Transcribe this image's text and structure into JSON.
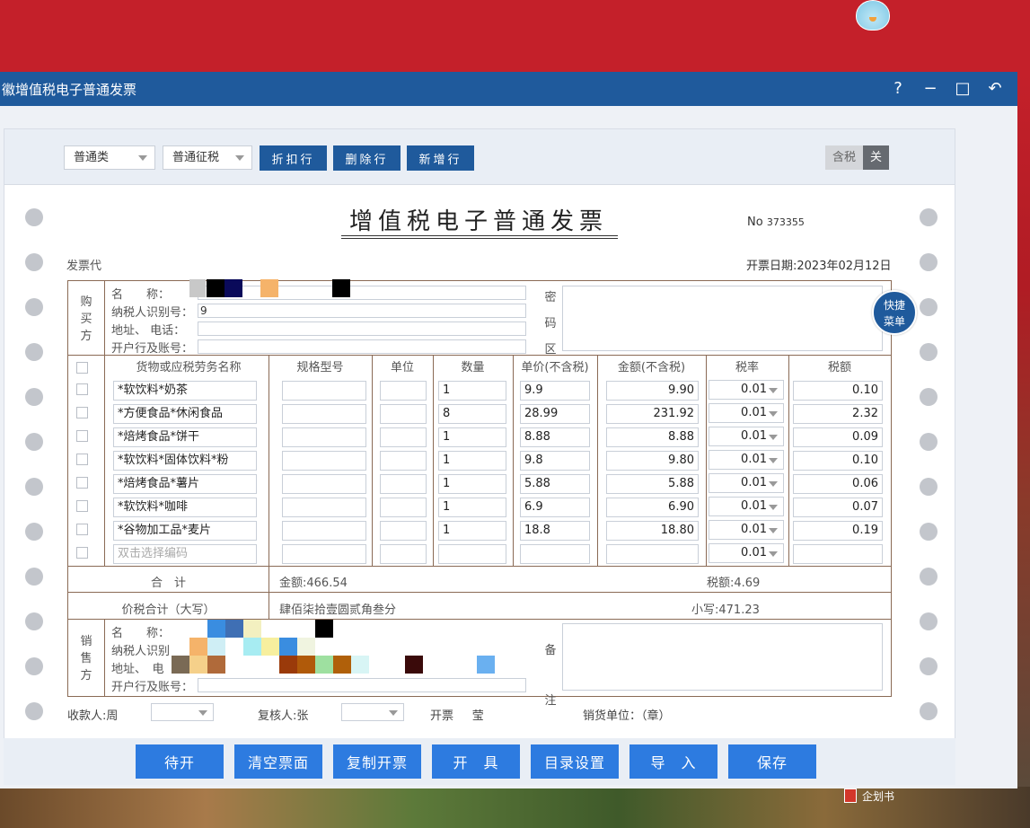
{
  "window": {
    "title": "徽增值税电子普通发票",
    "controls": [
      "?",
      "−",
      "□",
      "↶"
    ]
  },
  "toolbar": {
    "invoice_kind": "普通类",
    "tax_mode": "普通征税",
    "discount_btn": "折扣行",
    "delete_btn": "删除行",
    "add_btn": "新增行",
    "tax_included_on": "含税",
    "tax_included_off": "关"
  },
  "invoice": {
    "title": "增值税电子普通发票",
    "no_label": "No",
    "no_value": "373355",
    "code_label": "发票代",
    "date_label": "开票日期:",
    "date_value": "2023年02月12日"
  },
  "buyer": {
    "side_label": "购买方",
    "name_label": "名　　称：",
    "taxid_label": "纳税人识别号：",
    "taxid_value": "9",
    "addr_label": "地址、 电话：",
    "bank_label": "开户行及账号：",
    "cipher_label": "密码区"
  },
  "table": {
    "headers": [
      "货物或应税劳务名称",
      "规格型号",
      "单位",
      "数量",
      "单价(不含税)",
      "金额(不含税)",
      "税率",
      "税额"
    ],
    "rows": [
      {
        "name": "*软饮料*奶茶",
        "qty": "1",
        "price": "9.9",
        "amount": "9.90",
        "rate": "0.01",
        "tax": "0.10"
      },
      {
        "name": "*方便食品*休闲食品",
        "qty": "8",
        "price": "28.99",
        "amount": "231.92",
        "rate": "0.01",
        "tax": "2.32"
      },
      {
        "name": "*焙烤食品*饼干",
        "qty": "1",
        "price": "8.88",
        "amount": "8.88",
        "rate": "0.01",
        "tax": "0.09"
      },
      {
        "name": "*软饮料*固体饮料*粉",
        "qty": "1",
        "price": "9.8",
        "amount": "9.80",
        "rate": "0.01",
        "tax": "0.10"
      },
      {
        "name": "*焙烤食品*薯片",
        "qty": "1",
        "price": "5.88",
        "amount": "5.88",
        "rate": "0.01",
        "tax": "0.06"
      },
      {
        "name": "*软饮料*咖啡",
        "qty": "1",
        "price": "6.9",
        "amount": "6.90",
        "rate": "0.01",
        "tax": "0.07"
      },
      {
        "name": "*谷物加工品*麦片",
        "qty": "1",
        "price": "18.8",
        "amount": "18.80",
        "rate": "0.01",
        "tax": "0.19"
      }
    ],
    "empty_row": {
      "name_placeholder": "双击选择编码",
      "rate": "0.01"
    }
  },
  "totals": {
    "sum_label": "合　计",
    "amount_text": "金额:466.54",
    "tax_text": "税额:4.69",
    "grand_label": "价税合计（大写）",
    "grand_upper": "肆佰柒拾壹圆贰角叁分",
    "grand_lower": "小写:471.23"
  },
  "seller": {
    "side_label": "销售方",
    "name_label": "名　　称：",
    "taxid_label": "纳税人识别",
    "addr_label": "地址、　电",
    "bank_label": "开户行及账号：",
    "remark_label": "备注"
  },
  "footer": {
    "payee_label": "收款人:",
    "payee_value": "周",
    "reviewer_label": "复核人:",
    "reviewer_value": "张",
    "drawer_label": "开票",
    "drawer_value": "莹",
    "seller_stamp": "销货单位：（章）"
  },
  "float_menu": "快捷菜单",
  "actions": [
    "待开",
    "清空票面",
    "复制开票",
    "开　具",
    "目录设置",
    "导　入",
    "保存"
  ],
  "taskbar_file": "企划书"
}
